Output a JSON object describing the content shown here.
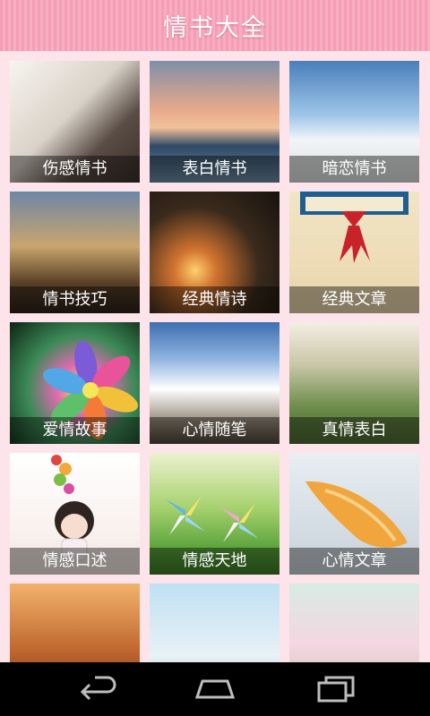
{
  "header": {
    "title": "情书大全"
  },
  "tiles": [
    {
      "label": "伤感情书"
    },
    {
      "label": "表白情书"
    },
    {
      "label": "暗恋情书"
    },
    {
      "label": "情书技巧"
    },
    {
      "label": "经典情诗"
    },
    {
      "label": "经典文章"
    },
    {
      "label": "爱情故事"
    },
    {
      "label": "心情随笔"
    },
    {
      "label": "真情表白"
    },
    {
      "label": "情感口述"
    },
    {
      "label": "情感天地"
    },
    {
      "label": "心情文章"
    }
  ],
  "nav": {
    "back_icon": "back-icon",
    "home_icon": "home-icon",
    "recents_icon": "recents-icon"
  }
}
